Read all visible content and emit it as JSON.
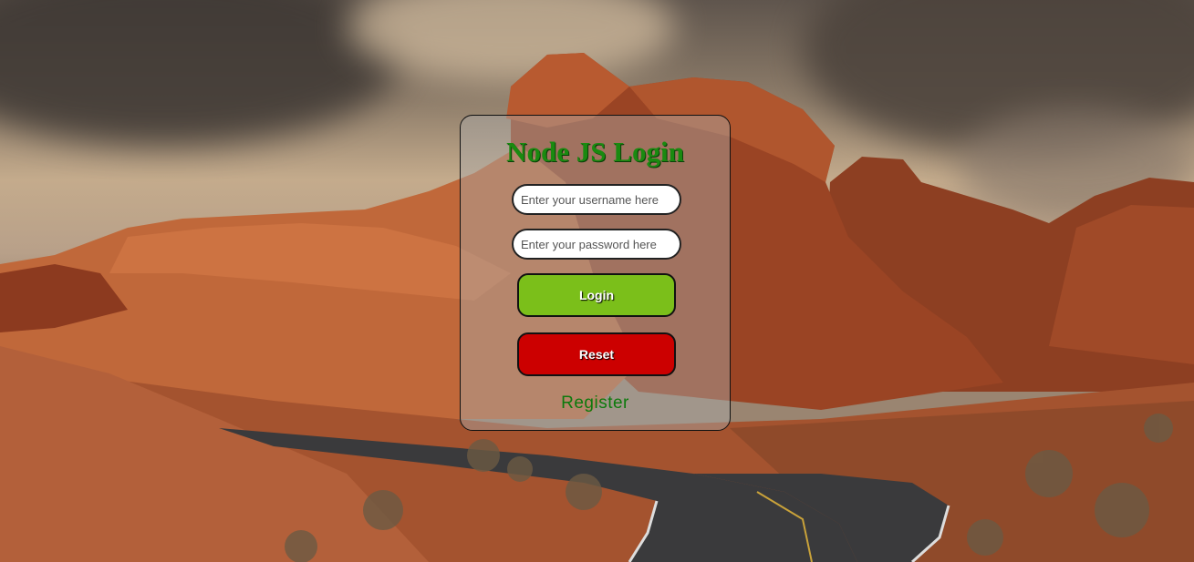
{
  "page": {
    "title": "Node JS Login"
  },
  "form": {
    "username_placeholder": "Enter your username here",
    "username_value": "",
    "password_placeholder": "Enter your password here",
    "password_value": "",
    "login_label": "Login",
    "reset_label": "Reset",
    "register_label": "Register"
  },
  "colors": {
    "title": "#1a8a10",
    "login_button": "#7bbf1a",
    "reset_button": "#cc0000",
    "register_link": "#0d7a0d"
  }
}
